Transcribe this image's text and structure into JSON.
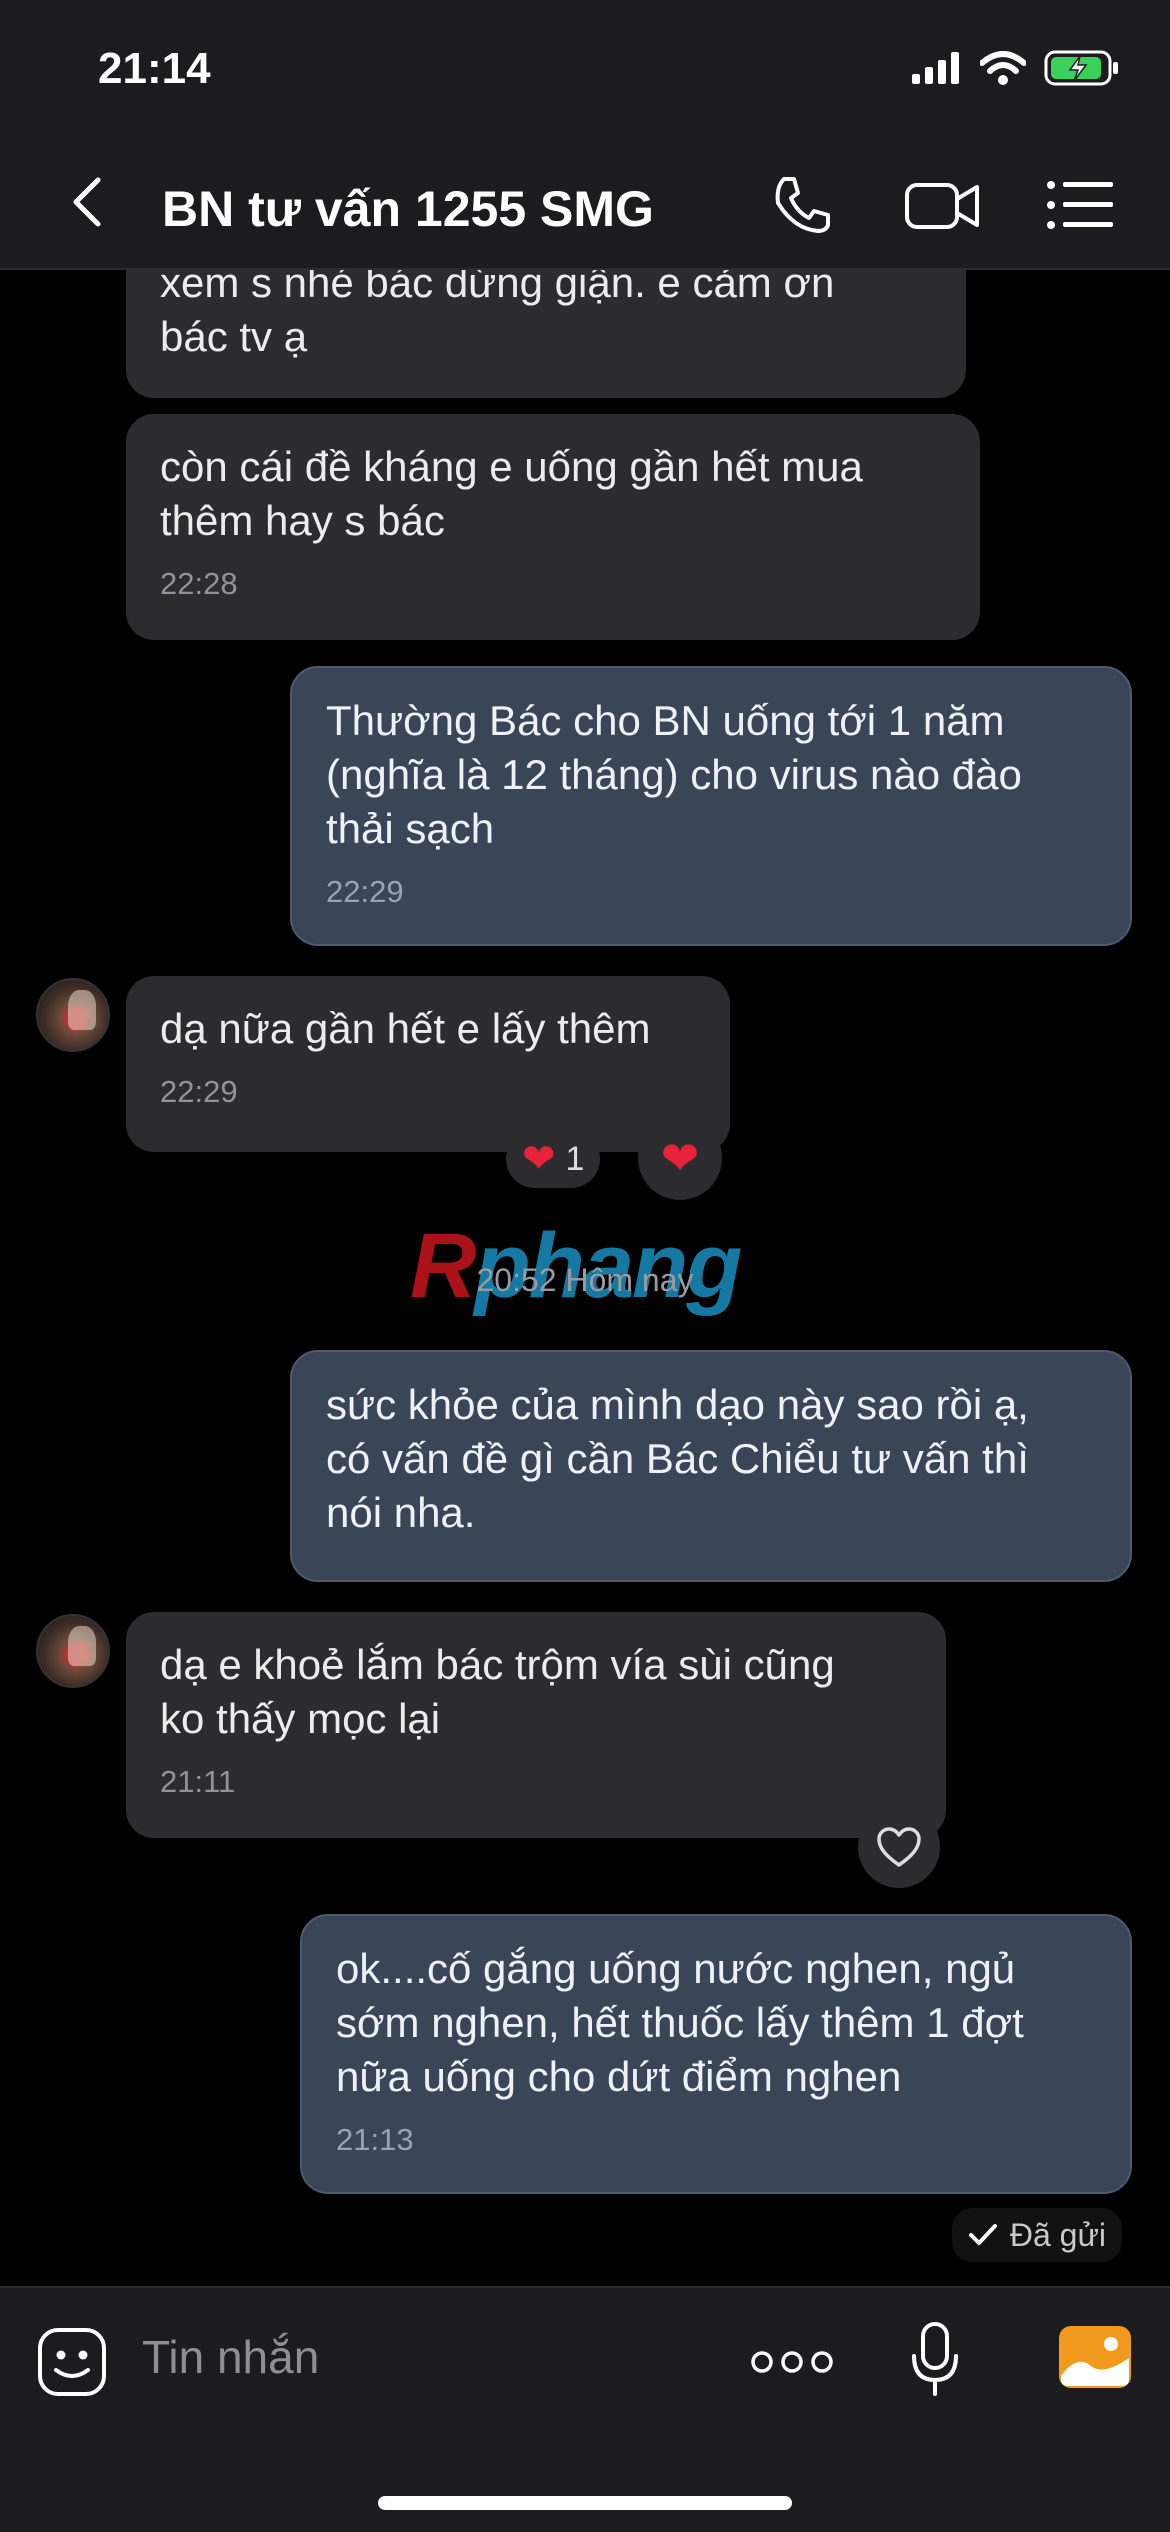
{
  "status_bar": {
    "time": "21:14"
  },
  "header": {
    "title": "BN tư vấn 1255 SMG"
  },
  "messages": [
    {
      "text": "xem s nhé bác dừng giận. e cảm ơn\nbác tv ạ"
    },
    {
      "text": "còn cái đề kháng e uống gần hết mua\nthêm hay s bác",
      "time": "22:28"
    },
    {
      "text": "Thường Bác cho BN uống tới 1 năm\n(nghĩa là 12 tháng) cho virus nào đào\nthải sạch",
      "time": "22:29"
    },
    {
      "text": "dạ nữa gần hết e lấy thêm",
      "time": "22:29",
      "reaction_count": "1"
    },
    {
      "text": "sức khỏe của mình dạo này sao rồi ạ,\ncó vấn đề gì cần Bác Chiểu tư vấn thì\nnói nha."
    },
    {
      "text": "dạ e khoẻ lắm bác trộm vía sùi cũng\nko thấy mọc lại",
      "time": "21:11"
    },
    {
      "text": "ok....cố gắng uống nước nghen, ngủ\nsớm nghen, hết thuốc lấy thêm 1 đợt\nnữa uống cho dứt điểm nghen",
      "time": "21:13"
    }
  ],
  "date_separator": "20:52 Hôm nay",
  "watermark": {
    "first": "R",
    "rest": "phang"
  },
  "sent_status": "Đã gửi",
  "composer": {
    "placeholder": "Tin nhắn"
  },
  "colors": {
    "incoming_bubble": "#2c2c2e",
    "outgoing_bubble": "#3a4658",
    "heart": "#e8223a",
    "gallery_button": "#f29a1e"
  }
}
